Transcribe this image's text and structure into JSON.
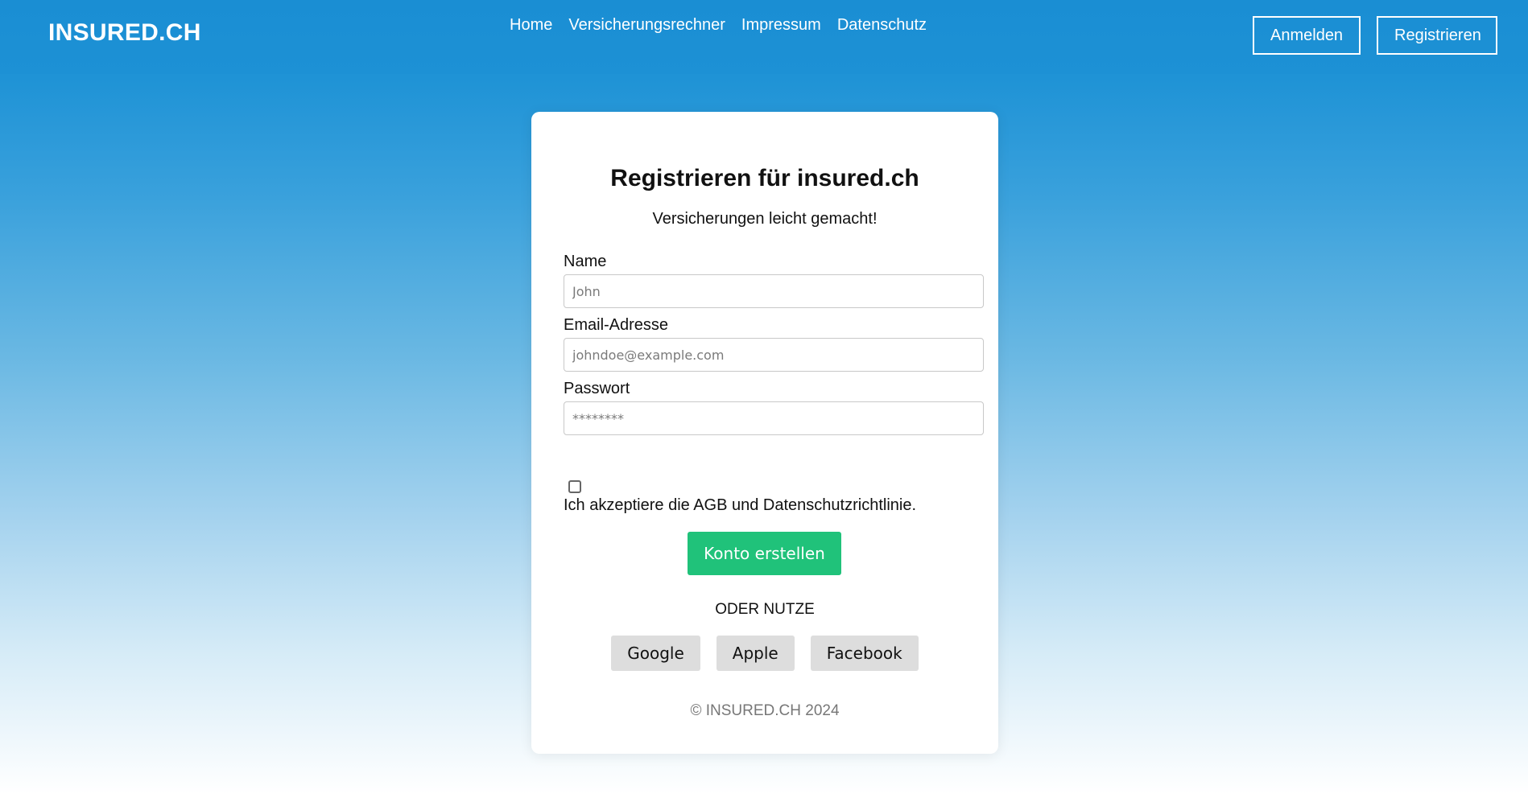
{
  "header": {
    "logo": "INSURED.CH",
    "nav": [
      "Home",
      "Versicherungsrechner",
      "Impressum",
      "Datenschutz"
    ],
    "login_label": "Anmelden",
    "register_label": "Registrieren"
  },
  "form": {
    "title": "Registrieren für insured.ch",
    "subtitle": "Versicherungen leicht gemacht!",
    "name_label": "Name",
    "name_placeholder": "John",
    "name_value": "",
    "email_label": "Email-Adresse",
    "email_placeholder": "johndoe@example.com",
    "email_value": "",
    "password_label": "Passwort",
    "password_placeholder": "********",
    "password_value": "",
    "consent_checked": false,
    "consent_text": "Ich akzeptiere die AGB und Datenschutzrichtlinie.",
    "submit_label": "Konto erstellen",
    "or_text": "ODER NUTZE",
    "social": [
      "Google",
      "Apple",
      "Facebook"
    ],
    "footer": "© INSURED.CH 2024"
  },
  "colors": {
    "header_blue": "#1b8fd4",
    "submit_green": "#20c27a",
    "social_gray": "#dddddd"
  }
}
